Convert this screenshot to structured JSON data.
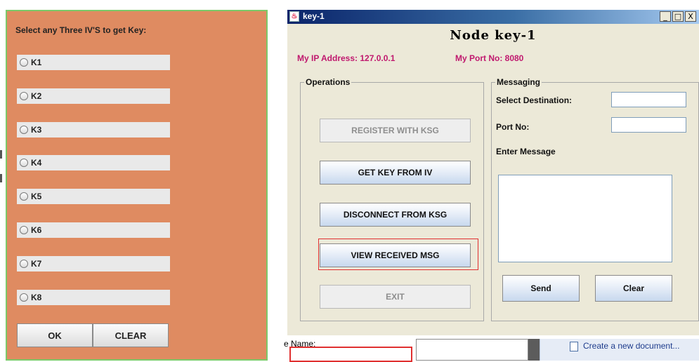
{
  "iv_window": {
    "prompt": "Select any Three IV'S to get Key:",
    "options": [
      "K1",
      "K2",
      "K3",
      "K4",
      "K5",
      "K6",
      "K7",
      "K8"
    ],
    "ok_label": "OK",
    "clear_label": "CLEAR",
    "colors": {
      "panel_bg": "#df8b61",
      "panel_border": "#7cc96a"
    }
  },
  "node_window": {
    "title": "key-1",
    "controls": {
      "minimize": "_",
      "maximize": "□",
      "close": "X"
    },
    "heading": "Node key-1",
    "ip_label": "My IP Address: 127.0.0.1",
    "port_label": "My Port No: 8080",
    "operations": {
      "title": "Operations",
      "register_label": "REGISTER WITH KSG",
      "get_key_label": "GET KEY FROM IV",
      "disconnect_label": "DISCONNECT FROM KSG",
      "view_msg_label": "VIEW RECEIVED MSG",
      "exit_label": "EXIT"
    },
    "messaging": {
      "title": "Messaging",
      "destination_label": "Select Destination:",
      "destination_value": "",
      "port_label": "Port No:",
      "port_value": "",
      "message_label": "Enter Message",
      "message_value": "",
      "send_label": "Send",
      "clear_label": "Clear"
    },
    "colors": {
      "titlebar": "#0a246a",
      "info_text": "#c0186e",
      "window_bg": "#ece9d8"
    }
  },
  "background": {
    "name_label": "e Name:",
    "task_link": "Create a new document..."
  }
}
